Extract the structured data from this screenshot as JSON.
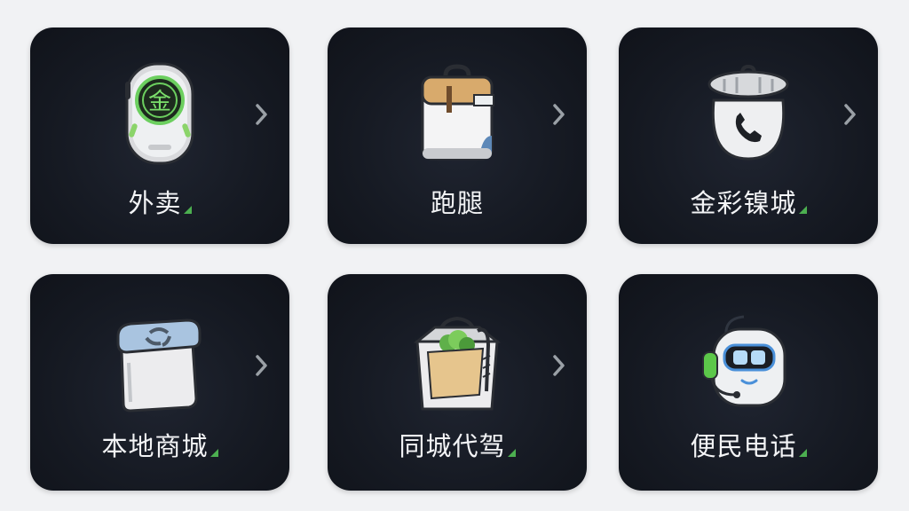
{
  "tiles": [
    {
      "label": "外卖",
      "icon": "gold-coin-pod-icon",
      "has_chevron": true,
      "has_mark": true
    },
    {
      "label": "跑腿",
      "icon": "delivery-bag-icon",
      "has_chevron": true,
      "has_mark": false
    },
    {
      "label": "金彩镍城",
      "icon": "phone-sack-icon",
      "has_chevron": true,
      "has_mark": true
    },
    {
      "label": "本地商城",
      "icon": "recycle-bin-box-icon",
      "has_chevron": true,
      "has_mark": true
    },
    {
      "label": "同城代驾",
      "icon": "produce-box-icon",
      "has_chevron": true,
      "has_mark": true
    },
    {
      "label": "便民电话",
      "icon": "robot-headset-icon",
      "has_chevron": false,
      "has_mark": true
    }
  ],
  "colors": {
    "background": "#f1f2f4",
    "tile": "#161a23",
    "label": "#f3f4f6",
    "accent_green": "#4caf50",
    "chevron": "#9aa0a6"
  }
}
